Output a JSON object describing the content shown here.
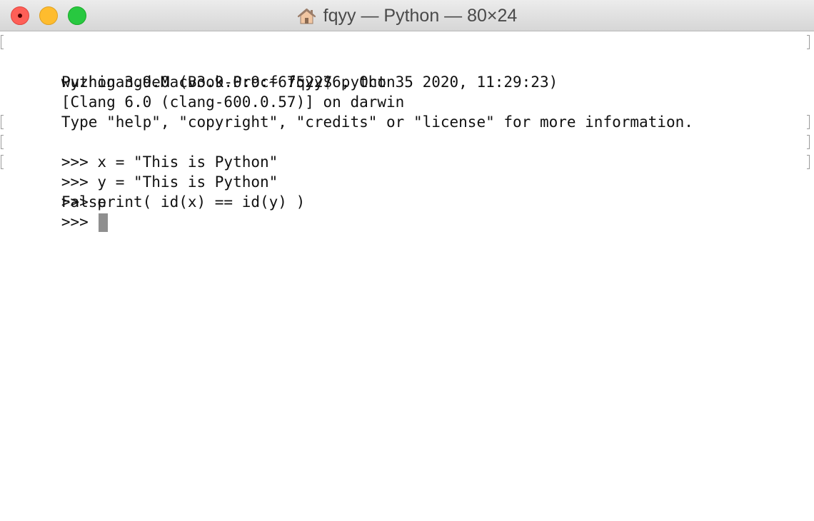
{
  "window": {
    "title": "fqyy — Python — 80×24",
    "title_icon": "home-icon"
  },
  "terminal": {
    "lines": [
      {
        "text": "wuzhigangdeMacBook-Pro:~ fqyy$ python3",
        "marked": true
      },
      {
        "text": "Python 3.9.0 (v3.9.0:9cf6752276, Oct  5 2020, 11:29:23)",
        "marked": false
      },
      {
        "text": "[Clang 6.0 (clang-600.0.57)] on darwin",
        "marked": false
      },
      {
        "text": "Type \"help\", \"copyright\", \"credits\" or \"license\" for more information.",
        "marked": false
      },
      {
        "text": ">>> x = \"This is Python\"",
        "marked": true
      },
      {
        "text": ">>> y = \"This is Python\"",
        "marked": true
      },
      {
        "text": ">>> print( id(x) == id(y) )",
        "marked": true
      },
      {
        "text": "False",
        "marked": false
      },
      {
        "text": ">>> ",
        "marked": false
      }
    ]
  },
  "colors": {
    "close": "#fe5f57",
    "minimize": "#febc2e",
    "zoom": "#28c840",
    "cursor": "#8f8f8f"
  }
}
